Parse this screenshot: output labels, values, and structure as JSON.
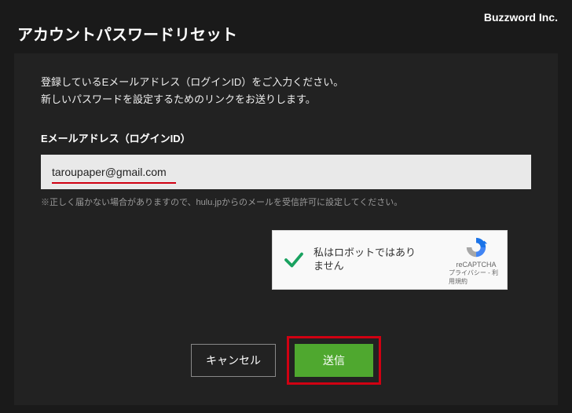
{
  "brand": "Buzzword Inc.",
  "page_title": "アカウントパスワードリセット",
  "instruction_line1": "登録しているEメールアドレス（ログインID）をご入力ください。",
  "instruction_line2": "新しいパスワードを設定するためのリンクをお送りします。",
  "field_label": "Eメールアドレス（ログインID）",
  "email_value": "taroupaper@gmail.com",
  "hint": "※正しく届かない場合がありますので、hulu.jpからのメールを受信許可に設定してください。",
  "recaptcha": {
    "label": "私はロボットではありません",
    "brand": "reCAPTCHA",
    "privacy": "プライバシー",
    "terms": "利用規約",
    "sep": " - "
  },
  "buttons": {
    "cancel": "キャンセル",
    "submit": "送信"
  }
}
